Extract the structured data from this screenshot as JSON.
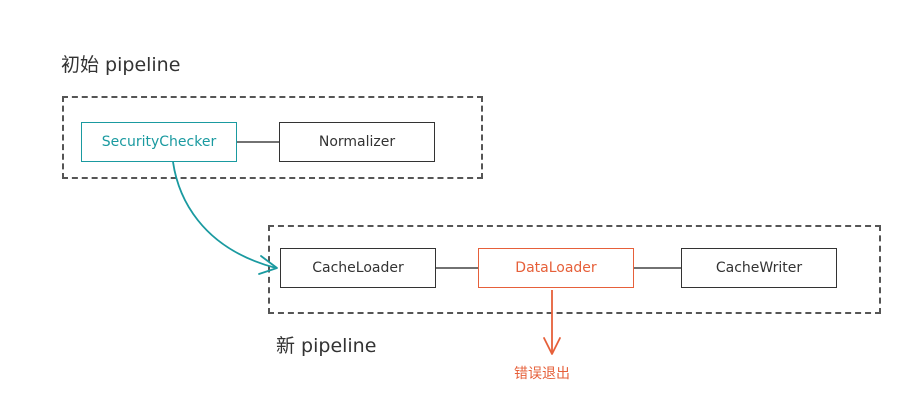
{
  "initial_pipeline": {
    "title": "初始 pipeline",
    "nodes": [
      "SecurityChecker",
      "Normalizer"
    ]
  },
  "new_pipeline": {
    "title": "新 pipeline",
    "nodes": [
      "CacheLoader",
      "DataLoader",
      "CacheWriter"
    ]
  },
  "error_label": "错误退出",
  "colors": {
    "teal": "#1a9aa0",
    "red": "#e6603a",
    "text": "#333333",
    "border": "#333333",
    "dashed": "#555555"
  }
}
